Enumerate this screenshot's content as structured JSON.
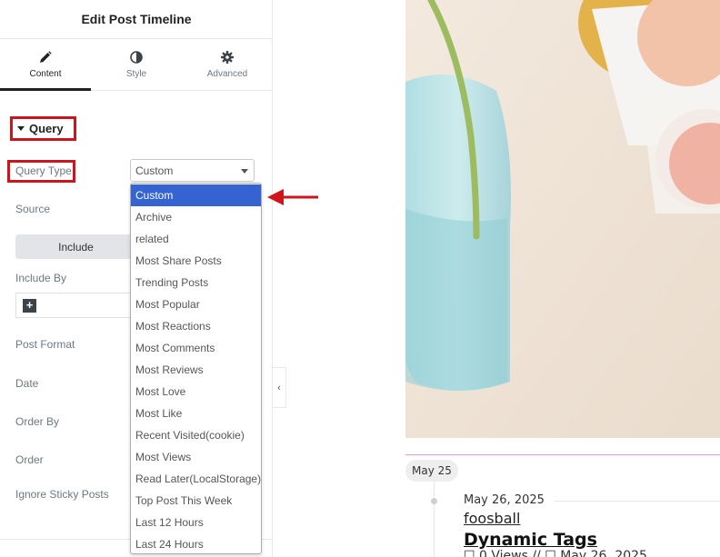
{
  "panel": {
    "title": "Edit Post Timeline",
    "tabs": [
      {
        "label": "Content",
        "icon": "pencil-icon",
        "active": true
      },
      {
        "label": "Style",
        "icon": "half-circle-icon",
        "active": false
      },
      {
        "label": "Advanced",
        "icon": "gear-icon",
        "active": false
      }
    ],
    "section_title": "Query",
    "labels": {
      "query_type": "Query Type",
      "source": "Source",
      "include_by": "Include By",
      "post_format": "Post Format",
      "date": "Date",
      "order_by": "Order By",
      "order": "Order",
      "ignore_sticky": "Ignore Sticky Posts"
    },
    "query_type_value": "Custom",
    "include_button": "Include",
    "add_icon": "plus-icon"
  },
  "dropdown": {
    "options": [
      "Custom",
      "Archive",
      "related",
      "Most Share Posts",
      "Trending Posts",
      "Most Popular",
      "Most Reactions",
      "Most Comments",
      "Most Reviews",
      "Most Love",
      "Most Like",
      "Recent Visited(cookie)",
      "Most Views",
      "Read Later(LocalStorage)",
      "Top Post This Week",
      "Last 12 Hours",
      "Last 24 Hours"
    ],
    "selected": "Custom"
  },
  "preview": {
    "date_pill": "May 25",
    "post_date": "May 26, 2025",
    "category": "foosball",
    "title": "Dynamic Tags",
    "meta": "☐ 0 Views // ☐ May 26, 2025"
  },
  "colors": {
    "highlight_red": "#d1141b",
    "selected_option": "#3563d1",
    "timeline_accent": "#e99be6"
  }
}
